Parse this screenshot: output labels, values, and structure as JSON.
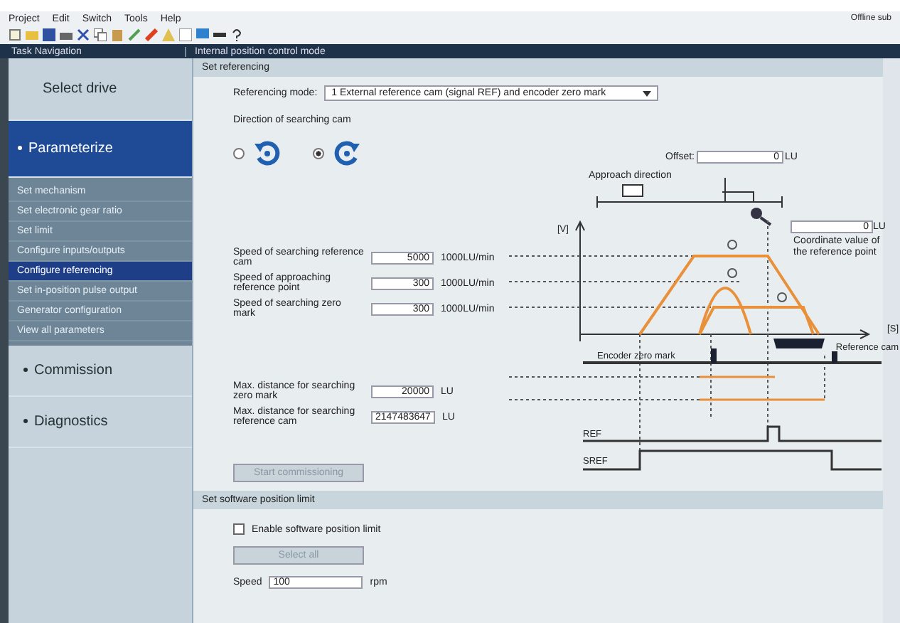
{
  "menu": [
    "Project",
    "Edit",
    "Switch",
    "Tools",
    "Help"
  ],
  "status": "Offline sub",
  "nav_title": "Task Navigation",
  "page_title": "Internal position control mode",
  "sidebar": {
    "items": [
      {
        "label": "Select drive",
        "selected": false
      },
      {
        "label": "Parameterize",
        "selected": true,
        "children": [
          {
            "label": "Set mechanism",
            "selected": false
          },
          {
            "label": "Set electronic gear ratio",
            "selected": false
          },
          {
            "label": "Set limit",
            "selected": false
          },
          {
            "label": "Configure inputs/outputs",
            "selected": false
          },
          {
            "label": "Configure referencing",
            "selected": true
          },
          {
            "label": "Set in-position pulse output",
            "selected": false
          },
          {
            "label": "Generator configuration",
            "selected": false
          },
          {
            "label": "View all parameters",
            "selected": false
          }
        ]
      },
      {
        "label": "Commission",
        "selected": false
      },
      {
        "label": "Diagnostics",
        "selected": false
      }
    ]
  },
  "referencing": {
    "title": "Set referencing",
    "mode_label": "Referencing mode:",
    "mode_value": "1 External reference cam (signal REF) and encoder zero mark",
    "direction_label": "Direction of searching cam",
    "directions": [
      {
        "kind": "ccw",
        "selected": false
      },
      {
        "kind": "cw",
        "selected": true
      }
    ],
    "offset": {
      "label": "Offset:",
      "value": "0",
      "unit": "LU"
    },
    "approach_label": "Approach direction",
    "coordinate": {
      "value": "0",
      "unit": "LU",
      "caption": "Coordinate value of the reference point"
    },
    "speeds": [
      {
        "label": "Speed of searching reference cam",
        "value": "5000",
        "unit": "1000LU/min"
      },
      {
        "label": "Speed of approaching reference point",
        "value": "300",
        "unit": "1000LU/min"
      },
      {
        "label": "Speed of searching zero mark",
        "value": "300",
        "unit": "1000LU/min"
      }
    ],
    "distances": [
      {
        "label": "Max. distance for searching zero mark",
        "value": "20000",
        "unit": "LU"
      },
      {
        "label": "Max. distance for searching reference cam",
        "value": "2147483647",
        "unit": "LU"
      }
    ],
    "button": {
      "label": "Start commissioning",
      "disabled": true
    },
    "diagram": {
      "y_axis": "[V]",
      "x_axis": "[S]",
      "cam": "Reference cam",
      "zero_mark": "Encoder zero mark",
      "signals": [
        "REF",
        "SREF"
      ]
    }
  },
  "software_limit": {
    "title": "Set software position limit",
    "enable": {
      "label": "Enable software position limit",
      "checked": false
    },
    "button": {
      "label": "Select all",
      "disabled": true
    },
    "speed": {
      "label": "Speed",
      "value": "100",
      "unit": "rpm"
    }
  }
}
